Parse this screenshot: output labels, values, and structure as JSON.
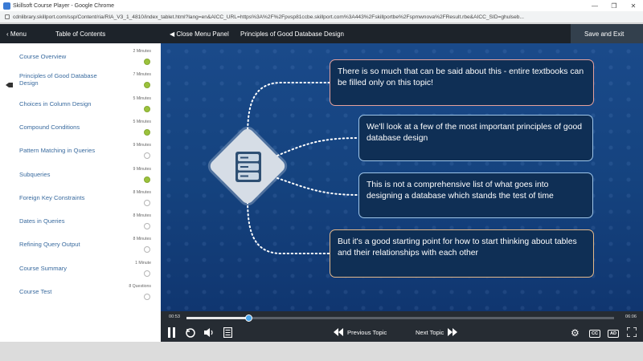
{
  "browser": {
    "window_title": "Skillsoft Course Player - Google Chrome",
    "url": "cdnlibrary.skillport.com/ssp/Content/ria/RIA_V3_1_4810/index_tablet.html?lang=en&AICC_URL=https%3A%2F%2Fpvsp81ccbe.skillport.com%3A443%2Fskillportbe%2Fspmwnova%2FResult.rbe&AICC_SID=ghulseb..."
  },
  "topbar": {
    "menu_label": "Menu",
    "toc_label": "Table of Contents",
    "close_panel_label": "Close Menu Panel",
    "lesson_title": "Principles of Good Database Design",
    "save_exit_label": "Save and Exit"
  },
  "sidebar": {
    "items": [
      {
        "label": "Course Overview",
        "duration": "2 Minutes",
        "status": "complete"
      },
      {
        "label": "Principles of Good Database Design",
        "duration": "7 Minutes",
        "status": "complete",
        "current": true
      },
      {
        "label": "Choices in Column Design",
        "duration": "5 Minutes",
        "status": "complete"
      },
      {
        "label": "Compound Conditions",
        "duration": "5 Minutes",
        "status": "complete"
      },
      {
        "label": "Pattern Matching in Queries",
        "duration": "9 Minutes",
        "status": "incomplete"
      },
      {
        "label": "Subqueries",
        "duration": "9 Minutes",
        "status": "complete"
      },
      {
        "label": "Foreign Key Constraints",
        "duration": "8 Minutes",
        "status": "incomplete"
      },
      {
        "label": "Dates in Queries",
        "duration": "8 Minutes",
        "status": "incomplete"
      },
      {
        "label": "Refining Query Output",
        "duration": "8 Minutes",
        "status": "incomplete"
      },
      {
        "label": "Course Summary",
        "duration": "1 Minute",
        "status": "incomplete"
      },
      {
        "label": "Course Test",
        "duration": "8 Questions",
        "status": "incomplete"
      }
    ]
  },
  "slide": {
    "icon": "database-server-icon",
    "cards": [
      "There is so much that can be said about this - entire textbooks can be filled only on this topic!",
      "We'll look at a few of the most important principles of good database design",
      "This is not a comprehensive list of what goes into designing a database which stands the test of time",
      "But it's a good starting point for how to start thinking about tables and their relationships with each other"
    ]
  },
  "player": {
    "elapsed": "00:53",
    "total": "06:06",
    "progress": 0.145,
    "previous_label": "Previous Topic",
    "next_label": "Next Topic",
    "cc_label": "CC",
    "ad_label": "AD"
  },
  "colors": {
    "accent_blue": "#4aa8ef",
    "complete_green": "#9bc23c",
    "topbar_dark": "#1d232a"
  }
}
